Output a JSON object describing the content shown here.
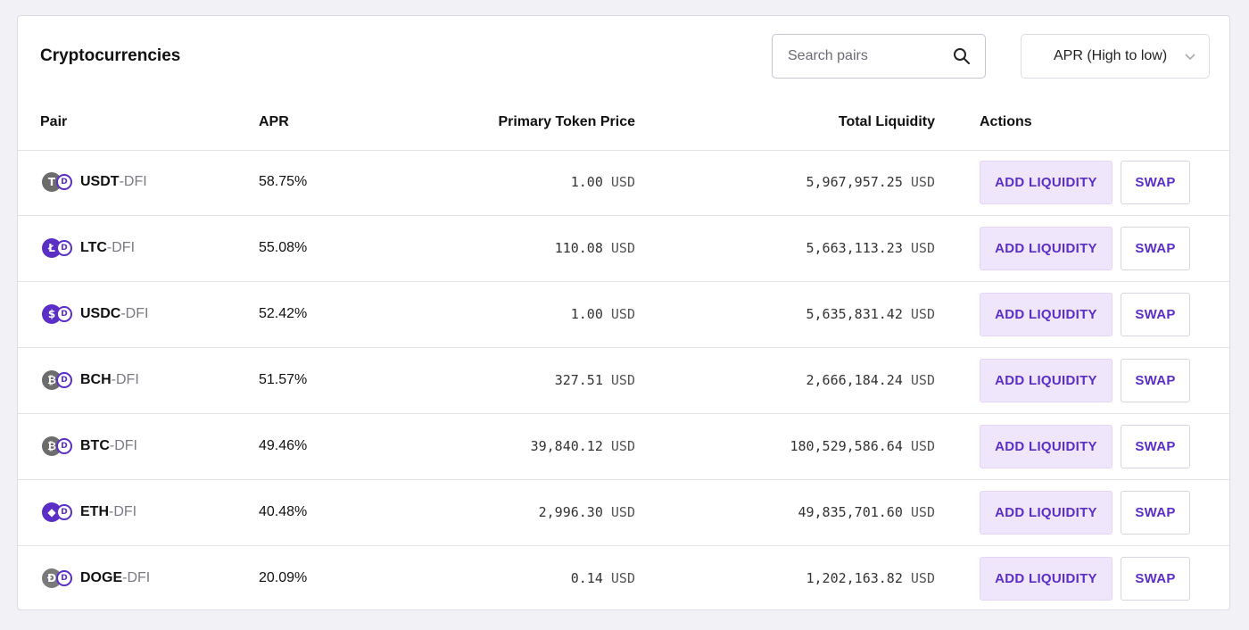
{
  "header": {
    "title": "Cryptocurrencies",
    "search_placeholder": "Search pairs",
    "sort_label": "APR (High to low)"
  },
  "columns": {
    "pair": "Pair",
    "apr": "APR",
    "price": "Primary Token Price",
    "liquidity": "Total Liquidity",
    "actions": "Actions"
  },
  "actions": {
    "add": "ADD LIQUIDITY",
    "swap": "SWAP"
  },
  "currency_unit": "USD",
  "pair_separator": "-",
  "colors": {
    "accent": "#5b2ec5",
    "accent_bg": "#efe6fb"
  },
  "rows": [
    {
      "symbol": "USDT",
      "quote": "DFI",
      "apr": "58.75%",
      "price": "1.00",
      "liquidity": "5,967,957.25",
      "icon": "tether-icon",
      "icon_glyph": "T",
      "icon_color": "#6c6c6c"
    },
    {
      "symbol": "LTC",
      "quote": "DFI",
      "apr": "55.08%",
      "price": "110.08",
      "liquidity": "5,663,113.23",
      "icon": "litecoin-icon",
      "icon_glyph": "Ł",
      "icon_color": "#5b2ec5"
    },
    {
      "symbol": "USDC",
      "quote": "DFI",
      "apr": "52.42%",
      "price": "1.00",
      "liquidity": "5,635,831.42",
      "icon": "usdc-icon",
      "icon_glyph": "$",
      "icon_color": "#5b2ec5"
    },
    {
      "symbol": "BCH",
      "quote": "DFI",
      "apr": "51.57%",
      "price": "327.51",
      "liquidity": "2,666,184.24",
      "icon": "bitcoin-cash-icon",
      "icon_glyph": "₿",
      "icon_color": "#6c6c6c"
    },
    {
      "symbol": "BTC",
      "quote": "DFI",
      "apr": "49.46%",
      "price": "39,840.12",
      "liquidity": "180,529,586.64",
      "icon": "bitcoin-icon",
      "icon_glyph": "₿",
      "icon_color": "#6c6c6c"
    },
    {
      "symbol": "ETH",
      "quote": "DFI",
      "apr": "40.48%",
      "price": "2,996.30",
      "liquidity": "49,835,701.60",
      "icon": "ethereum-icon",
      "icon_glyph": "◆",
      "icon_color": "#5b2ec5"
    },
    {
      "symbol": "DOGE",
      "quote": "DFI",
      "apr": "20.09%",
      "price": "0.14",
      "liquidity": "1,202,163.82",
      "icon": "dogecoin-icon",
      "icon_glyph": "Ð",
      "icon_color": "#7a7a7a"
    }
  ]
}
